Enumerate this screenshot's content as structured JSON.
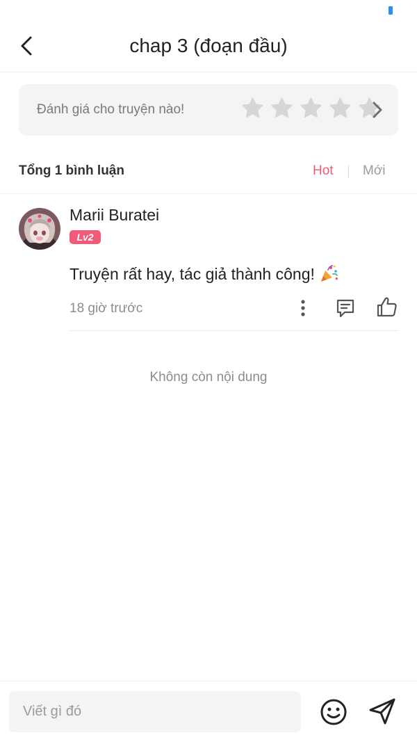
{
  "header": {
    "title": "chap 3 (đoạn đầu)"
  },
  "rating": {
    "prompt": "Đánh giá cho truyện nào!",
    "max_stars": 5,
    "selected_stars": 0
  },
  "comments": {
    "total_label": "Tổng 1 bình luận",
    "sort_hot": "Hot",
    "sort_new": "Mới",
    "active_sort": "Hot",
    "items": [
      {
        "username": "Marii Buratei",
        "level": "Lv2",
        "text": "Truyện rất hay, tác giả thành công!",
        "emoji": "party-popper-icon",
        "time": "18 giờ trước"
      }
    ],
    "end_note": "Không còn nội dung"
  },
  "composer": {
    "placeholder": "Viết gì đó"
  },
  "colors": {
    "accent": "#f25a7a",
    "status_indicator": "#2b8ee8",
    "muted_text": "#8c8c8c",
    "input_bg": "#f4f4f4"
  }
}
